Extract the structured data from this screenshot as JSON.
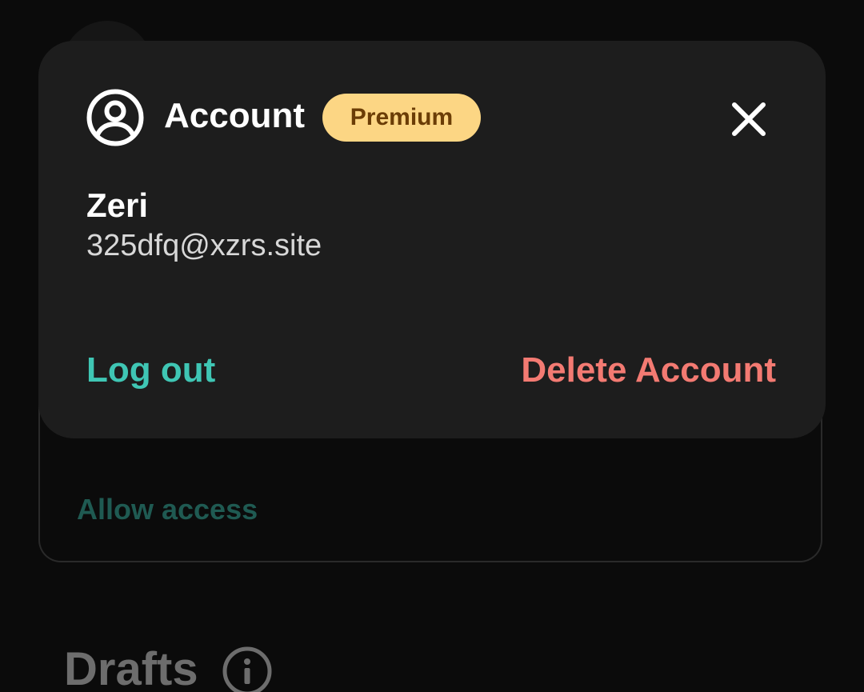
{
  "popup": {
    "title": "Account",
    "badge": "Premium",
    "icons": {
      "account": "account-circle-icon",
      "close": "close-icon"
    }
  },
  "user": {
    "name": "Zeri",
    "email": "325dfq@xzrs.site"
  },
  "actions": {
    "logout_label": "Log out",
    "delete_label": "Delete Account"
  },
  "background": {
    "allow_access_label": "Allow access",
    "drafts_title": "Drafts",
    "info_icon": "info-icon"
  },
  "colors": {
    "background": "#0b0b0b",
    "popup_bg": "#1d1d1d",
    "badge_bg": "#fcd684",
    "badge_text": "#6b3d06",
    "logout": "#3fc6b4",
    "delete": "#f37a72",
    "allow_access": "#1f5a52",
    "muted": "#6d6d6d"
  }
}
